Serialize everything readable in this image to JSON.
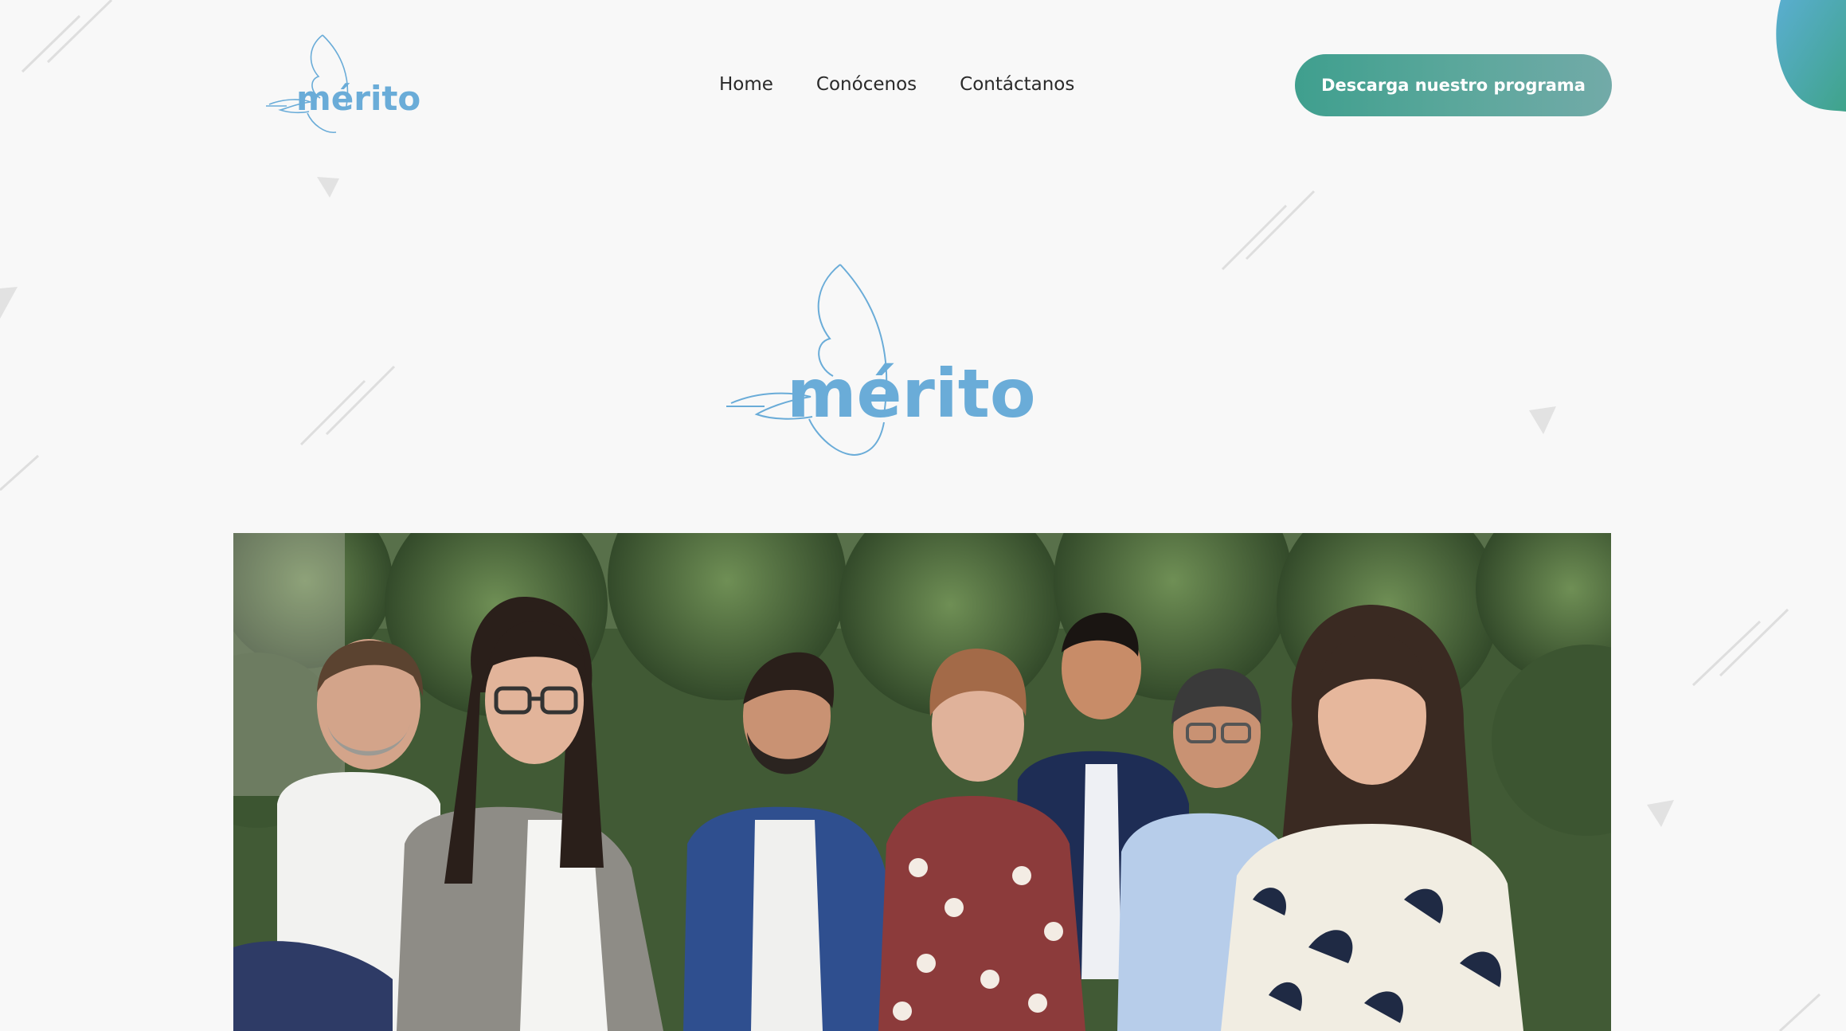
{
  "header": {
    "logo_text": "mérito",
    "nav": [
      {
        "label": "Home"
      },
      {
        "label": "Conócenos"
      },
      {
        "label": "Contáctanos"
      }
    ],
    "cta_label": "Descarga nuestro programa"
  },
  "hero": {
    "logo_text": "mérito"
  },
  "colors": {
    "brand_blue": "#6aacd8",
    "cta_start": "#3f9f8e",
    "cta_end": "#72aaa8",
    "background": "#f8f8f8"
  },
  "icons": {
    "logo": "wing-logo-icon",
    "corner_blob": "teal-blob-shape"
  }
}
